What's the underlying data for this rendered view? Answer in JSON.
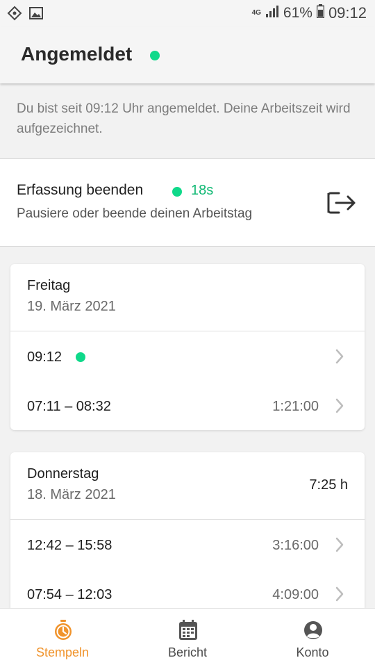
{
  "status_bar": {
    "network": "4G",
    "battery_percent": "61%",
    "time": "09:12",
    "icons": [
      "location-icon",
      "image-notification-icon",
      "signal-icon",
      "battery-icon"
    ]
  },
  "header": {
    "title": "Angemeldet",
    "status_color": "#0fd98a"
  },
  "info_text": "Du bist seit 09:12 Uhr angemeldet. Deine Arbeitszeit wird aufgezeichnet.",
  "end_tracking": {
    "title": "Erfassung beenden",
    "elapsed": "18s",
    "subtitle": "Pausiere oder beende deinen Arbeitstag",
    "icon": "logout-icon"
  },
  "days": [
    {
      "day": "Freitag",
      "date": "19. März 2021",
      "total": "",
      "entries": [
        {
          "time": "09:12",
          "duration": "",
          "active": true
        },
        {
          "time": "07:11 – 08:32",
          "duration": "1:21:00",
          "active": false
        }
      ]
    },
    {
      "day": "Donnerstag",
      "date": "18. März 2021",
      "total": "7:25 h",
      "entries": [
        {
          "time": "12:42 – 15:58",
          "duration": "3:16:00",
          "active": false
        },
        {
          "time": "07:54 – 12:03",
          "duration": "4:09:00",
          "active": false
        }
      ]
    }
  ],
  "bottom_nav": [
    {
      "label": "Stempeln",
      "icon": "stopwatch-icon",
      "active": true
    },
    {
      "label": "Bericht",
      "icon": "calendar-icon",
      "active": false
    },
    {
      "label": "Konto",
      "icon": "account-icon",
      "active": false
    }
  ],
  "colors": {
    "accent": "#f0932b",
    "active_green": "#0fd98a"
  }
}
